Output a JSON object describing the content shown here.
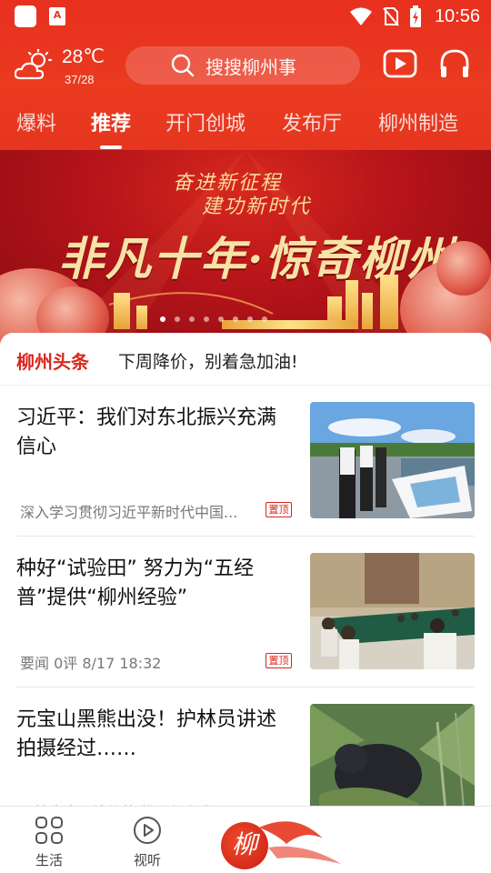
{
  "status_bar": {
    "app_icon_label": "A",
    "time": "10:56"
  },
  "header": {
    "weather": {
      "temperature": "28℃",
      "range": "37/28",
      "icon": "sun-cloud-icon"
    },
    "search": {
      "placeholder": "搜搜柳州事"
    },
    "icons": {
      "video": "video-icon",
      "audio": "headphones-icon"
    }
  },
  "tabs": [
    {
      "label": "爆料",
      "active": false
    },
    {
      "label": "推荐",
      "active": true
    },
    {
      "label": "开门创城",
      "active": false
    },
    {
      "label": "发布厅",
      "active": false
    },
    {
      "label": "柳州制造",
      "active": false
    }
  ],
  "banner": {
    "line1": "奋进新征程",
    "line2": "建功新时代",
    "title": "非凡十年·惊奇柳州",
    "dot_count": 8,
    "active_dot": 0
  },
  "headline": {
    "label": "柳州头条",
    "text": "下周降价，别着急加油!"
  },
  "news": [
    {
      "title": "习近平：我们对东北振兴充满信心",
      "meta": "深入学习贯彻习近平新时代中国...",
      "pin_label": "置顶",
      "pinned": true
    },
    {
      "title": "种好“试验田” 努力为“五经普”提供“柳州经验”",
      "meta": "要闻   0评   8/17 18:32",
      "pin_label": "置顶",
      "pinned": true
    },
    {
      "title": "元宝山黑熊出没！护林员讲述拍摄经过……",
      "meta": "厚植生态环境优势 推动绿色发展",
      "pinned": false
    }
  ],
  "bottom_nav": {
    "items": [
      {
        "label": "生活",
        "icon": "grid-icon"
      },
      {
        "label": "视听",
        "icon": "play-circle-icon"
      }
    ],
    "center_glyph": "柳"
  },
  "colors": {
    "brand_red": "#e6361f",
    "accent_red": "#d9261c"
  }
}
